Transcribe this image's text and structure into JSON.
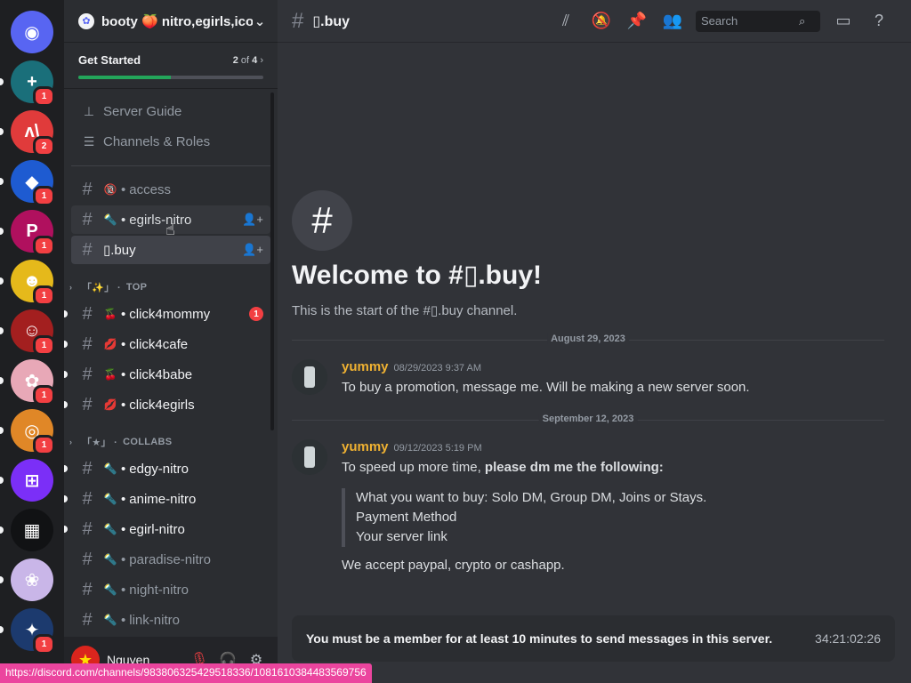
{
  "server_rail": {
    "items": [
      {
        "name": "discord-home",
        "glyph": "◉",
        "color": "#5865f2",
        "badge": ""
      },
      {
        "name": "server-1",
        "glyph": "+",
        "color": "#1a6f7a",
        "badge": "1"
      },
      {
        "name": "server-2",
        "glyph": "ʌ\\",
        "color": "#e03b3b",
        "badge": "2"
      },
      {
        "name": "server-3",
        "glyph": "◆",
        "color": "#1e5bd1",
        "badge": "1"
      },
      {
        "name": "server-4",
        "glyph": "P",
        "color": "#b0105e",
        "badge": "1"
      },
      {
        "name": "server-5",
        "glyph": "☻",
        "color": "#e5b91b",
        "badge": "1"
      },
      {
        "name": "server-6",
        "glyph": "☺",
        "color": "#a31f1f",
        "badge": "1"
      },
      {
        "name": "server-7",
        "glyph": "✿",
        "color": "#e8a8b7",
        "badge": "1"
      },
      {
        "name": "server-8",
        "glyph": "◎",
        "color": "#e08727",
        "badge": "1"
      },
      {
        "name": "server-9",
        "glyph": "⊞",
        "color": "#7b2ff7",
        "badge": ""
      },
      {
        "name": "server-10",
        "glyph": "▦",
        "color": "#111214",
        "badge": ""
      },
      {
        "name": "server-11",
        "glyph": "❀",
        "color": "#c9b6e8",
        "badge": ""
      },
      {
        "name": "server-12",
        "glyph": "✦",
        "color": "#1c3a6e",
        "badge": "1"
      }
    ]
  },
  "server_header": {
    "icon": "✿",
    "name": "booty 🍑 nitro,egirls,ico",
    "chevron": "⌄"
  },
  "get_started": {
    "label": "Get Started",
    "progress_current": "2",
    "progress_of": " of ",
    "progress_total": "4",
    "chevron": "›",
    "progress_fraction": 0.5
  },
  "nav": [
    {
      "icon": "⊥",
      "label": "Server Guide"
    },
    {
      "icon": "☰",
      "label": "Channels & Roles"
    }
  ],
  "channels_top": [
    {
      "emoji": "🔞",
      "label": "access",
      "state": "normal",
      "invite": ""
    },
    {
      "emoji": "🔦",
      "label": "egirls-nitro",
      "state": "hover",
      "invite": "👤+"
    },
    {
      "emoji": "",
      "label": "\u0000.buy",
      "display": "▯.buy",
      "state": "active",
      "invite": "👤+"
    }
  ],
  "categories": [
    {
      "bracket": "「✨」",
      "label": "TOP",
      "channels": [
        {
          "emoji": "🍒",
          "label": "click4mommy",
          "state": "unread",
          "mention": "1"
        },
        {
          "emoji": "💋",
          "label": "click4cafe",
          "state": "unread",
          "mention": ""
        },
        {
          "emoji": "🍒",
          "label": "click4babe",
          "state": "unread",
          "mention": ""
        },
        {
          "emoji": "💋",
          "label": "click4egirls",
          "state": "unread",
          "mention": ""
        }
      ]
    },
    {
      "bracket": "「★」",
      "label": "COLLABS",
      "channels": [
        {
          "emoji": "🔦",
          "label": "edgy-nitro",
          "state": "unread",
          "mention": ""
        },
        {
          "emoji": "🔦",
          "label": "anime-nitro",
          "state": "unread",
          "mention": ""
        },
        {
          "emoji": "🔦",
          "label": "egirl-nitro",
          "state": "unread",
          "mention": ""
        },
        {
          "emoji": "🔦",
          "label": "paradise-nitro",
          "state": "normal",
          "mention": ""
        },
        {
          "emoji": "🔦",
          "label": "night-nitro",
          "state": "normal",
          "mention": ""
        },
        {
          "emoji": "🔦",
          "label": "link-nitro",
          "state": "normal",
          "mention": ""
        }
      ]
    }
  ],
  "user_panel": {
    "avatar": "★",
    "name": "Nguyen",
    "mic_icon": "🎙",
    "headset_icon": "🎧",
    "settings_icon": "⚙"
  },
  "topbar": {
    "title": "▯.buy",
    "search_placeholder": "Search",
    "icons": [
      "threads-icon",
      "mute-bell-icon",
      "pin-icon",
      "members-icon",
      "inbox-icon",
      "help-icon"
    ]
  },
  "welcome": {
    "title": "Welcome to #▯.buy!",
    "subtitle": "This is the start of the #▯.buy channel."
  },
  "messages": [
    {
      "date": "August 29, 2023",
      "author": "yummy",
      "time": "08/29/2023 9:37 AM",
      "lines": [
        "To buy a promotion, message me. Will be making a new server soon."
      ]
    },
    {
      "date": "September 12, 2023",
      "author": "yummy",
      "time": "09/12/2023 5:19 PM",
      "intro": "To speed up more time, ",
      "intro_bold": "please dm me the following:",
      "quote": [
        "What you want to buy: Solo DM, Group DM, Joins or Stays.",
        "Payment Method",
        "Your server link"
      ],
      "outro": "We accept paypal, crypto or cashapp."
    }
  ],
  "locked_notice": {
    "text": "You must be a member for at least 10 minutes to send messages in this server.",
    "timer": "34:21:02:26"
  },
  "status_url": "https://discord.com/channels/983806325429518336/1081610384483569756",
  "colors": {
    "accent": "#5865f2",
    "author": "#f0b232",
    "badge": "#f23f42",
    "progress": "#23a55a",
    "urlbar": "#eb459e"
  }
}
